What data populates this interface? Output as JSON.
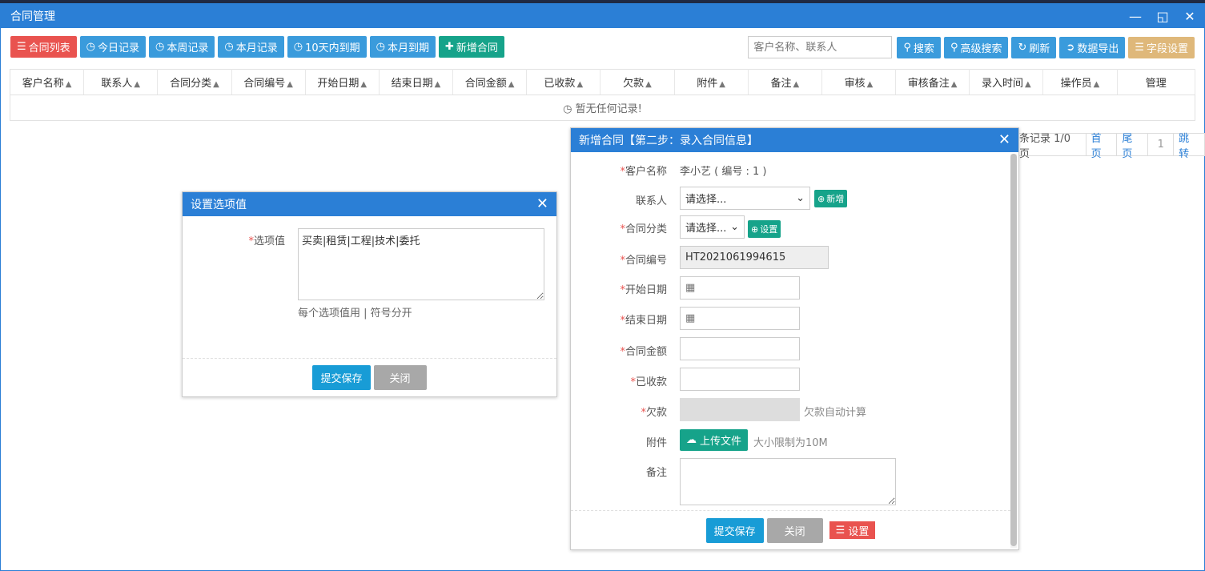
{
  "window": {
    "title": "合同管理"
  },
  "toolbar": {
    "buttons": [
      {
        "label": "合同列表",
        "icon": "list-icon"
      },
      {
        "label": "今日记录",
        "icon": "clock-icon"
      },
      {
        "label": "本周记录",
        "icon": "clock-icon"
      },
      {
        "label": "本月记录",
        "icon": "clock-icon"
      },
      {
        "label": "10天内到期",
        "icon": "clock-icon"
      },
      {
        "label": "本月到期",
        "icon": "clock-icon"
      },
      {
        "label": "新增合同",
        "icon": "plus-icon"
      }
    ],
    "search_placeholder": "客户名称、联系人",
    "search_label": "搜索",
    "advanced_search_label": "高级搜索",
    "refresh_label": "刷新",
    "export_label": "数据导出",
    "field_settings_label": "字段设置"
  },
  "table": {
    "columns": [
      "客户名称",
      "联系人",
      "合同分类",
      "合同编号",
      "开始日期",
      "结束日期",
      "合同金额",
      "已收款",
      "欠款",
      "附件",
      "备注",
      "审核",
      "审核备注",
      "录入时间",
      "操作员",
      "管理"
    ],
    "empty_text": "暂无任何记录!"
  },
  "pager": {
    "info": "条记录 1/0页",
    "first": "首页",
    "last": "尾页",
    "page": "1",
    "jump": "跳转"
  },
  "option_dialog": {
    "title": "设置选项值",
    "field_label": "选项值",
    "value": "买卖|租赁|工程|技术|委托",
    "hint": "每个选项值用 | 符号分开",
    "submit": "提交保存",
    "close": "关闭"
  },
  "contract_dialog": {
    "title": "新增合同【第二步：录入合同信息】",
    "customer_label": "客户名称",
    "customer_value": "李小艺 ( 编号 : 1 )",
    "contact_label": "联系人",
    "contact_select": "请选择...",
    "new_label": "新增",
    "category_label": "合同分类",
    "category_select": "请选择...",
    "setting_label": "设置",
    "number_label": "合同编号",
    "number_value": "HT2021061994615",
    "start_label": "开始日期",
    "end_label": "结束日期",
    "amount_label": "合同金额",
    "received_label": "已收款",
    "owed_label": "欠款",
    "owed_hint": "欠款自动计算",
    "attach_label": "附件",
    "upload_label": "上传文件",
    "upload_hint": "大小限制为10M",
    "remark_label": "备注",
    "submit": "提交保存",
    "close": "关闭",
    "settings": "设置"
  }
}
